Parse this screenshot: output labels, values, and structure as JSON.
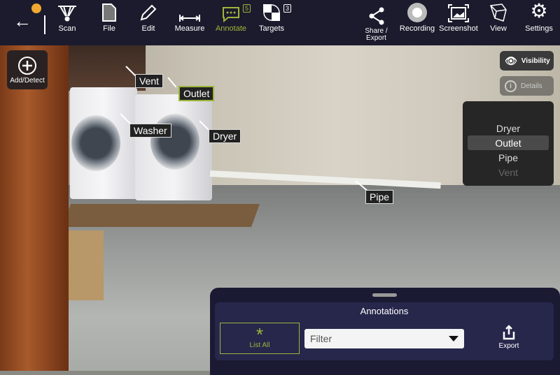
{
  "toolbar": {
    "items": [
      {
        "label": "Scan"
      },
      {
        "label": "File"
      },
      {
        "label": "Edit"
      },
      {
        "label": "Measure"
      },
      {
        "label": "Annotate",
        "badge": "5"
      },
      {
        "label": "Targets",
        "badge": "3"
      },
      {
        "label": "Share /\nExport"
      },
      {
        "label": "Recording"
      },
      {
        "label": "Screenshot"
      },
      {
        "label": "View"
      },
      {
        "label": "Settings"
      }
    ]
  },
  "colors": {
    "accent": "#9bb53a",
    "toolbar_bg": "#1c1b2d",
    "status_dot": "#f0a830"
  },
  "add_detect": "Add/Detect",
  "side": {
    "visibility": "Visibility",
    "details": "Details"
  },
  "picker": {
    "items": [
      "Dryer",
      "Outlet",
      "Pipe",
      "Vent"
    ],
    "selected": "Outlet"
  },
  "labels": {
    "vent": "Vent",
    "outlet": "Outlet",
    "washer": "Washer",
    "dryer": "Dryer",
    "pipe": "Pipe"
  },
  "panel": {
    "title": "Annotations",
    "list_all": "List All",
    "filter_placeholder": "Filter",
    "export": "Export"
  }
}
